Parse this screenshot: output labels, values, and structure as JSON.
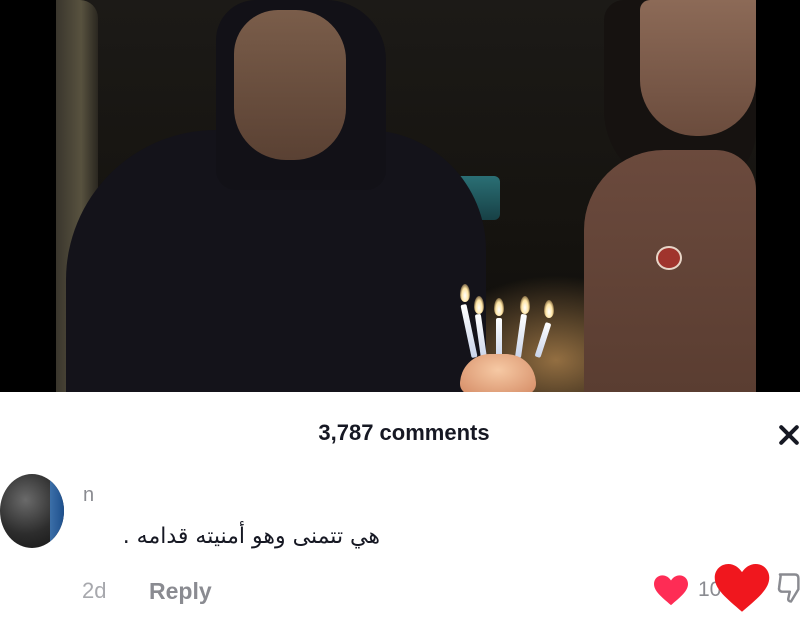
{
  "comments_panel": {
    "title": "3,787 comments"
  },
  "comment": {
    "username": "n",
    "text": "هي تتمنى وهو أمنيته قدامه .",
    "time": "2d",
    "reply_label": "Reply",
    "like_count": "10"
  },
  "icons": {
    "close": "close-icon",
    "like": "heart-icon",
    "dislike": "thumbs-down-icon"
  },
  "colors": {
    "like_red": "#fe2c55",
    "text_primary": "#161823",
    "text_secondary": "#8a8b91"
  }
}
